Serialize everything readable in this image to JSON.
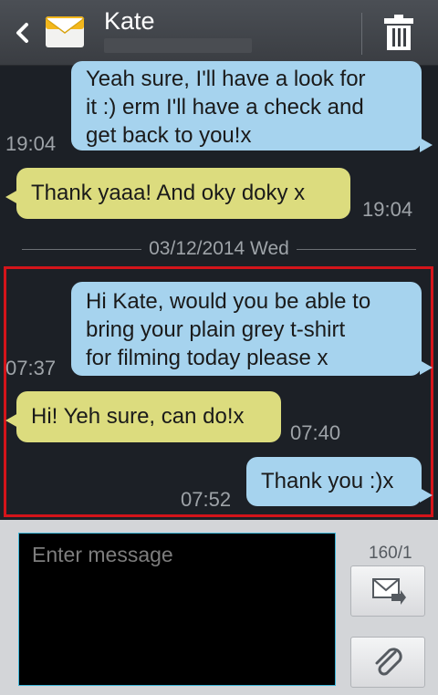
{
  "header": {
    "contact_name": "Kate"
  },
  "messages": [
    {
      "direction": "out",
      "lines": [
        "Yeah sure, I'll have a look for",
        "it :) erm I'll have a check and",
        "get back to you!x"
      ],
      "time": "19:04"
    },
    {
      "direction": "in",
      "lines": [
        "Thank yaaa! And oky doky x"
      ],
      "time": "19:04"
    },
    {
      "direction": "out",
      "lines": [
        "Hi Kate, would you be able to",
        "bring your plain grey t-shirt",
        "for filming today please x"
      ],
      "time": "07:37"
    },
    {
      "direction": "in",
      "lines": [
        "Hi! Yeh sure, can do!x"
      ],
      "time": "07:40"
    },
    {
      "direction": "out",
      "lines": [
        "Thank you :)x"
      ],
      "time": "07:52"
    }
  ],
  "date_separator": "03/12/2014 Wed",
  "composer": {
    "placeholder": "Enter message",
    "char_count": "160/1"
  },
  "colors": {
    "outgoing_bubble": "#a6d3ee",
    "incoming_bubble": "#dcdc7e",
    "highlight_border": "#d4141a"
  },
  "icons": {
    "back": "chevron-left-icon",
    "contact": "envelope-icon",
    "delete": "trash-icon",
    "send": "send-message-icon",
    "attach": "paperclip-icon"
  }
}
